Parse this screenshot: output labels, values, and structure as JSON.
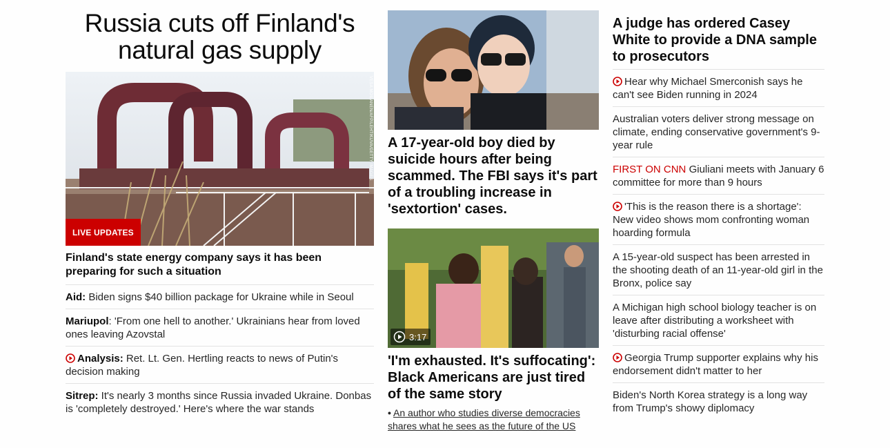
{
  "lead": {
    "headline": "Russia cuts off Finland's natural gas supply",
    "photo_credit": "VESA MOILANEN/AFP/LEHTIKUVA/GETTY IMAGES",
    "badge": "LIVE UPDATES",
    "subheadline": "Finland's state energy company says it has been preparing for such a situation",
    "related": [
      {
        "kicker": "Aid:",
        "text": " Biden signs $40 billion package for Ukraine while in Seoul",
        "video": false
      },
      {
        "kicker": "Mariupol",
        "text": ": 'From one hell to another.' Ukrainians hear from loved ones leaving Azovstal",
        "video": false
      },
      {
        "kicker": "Analysis:",
        "text": " Ret. Lt. Gen. Hertling reacts to news of Putin's decision making",
        "video": true
      },
      {
        "kicker": "Sitrep:",
        "text": " It's nearly 3 months since Russia invaded Ukraine. Donbas is 'completely destroyed.' Here's where the war stands",
        "video": false
      }
    ]
  },
  "middle": {
    "story1": {
      "headline": "A 17-year-old boy died by suicide hours after being scammed. The FBI says it's part of a troubling increase in 'sextortion' cases."
    },
    "story2": {
      "video_duration": "3:17",
      "headline": "'I'm exhausted. It's suffocating': Black Americans are just tired of the same story",
      "related_bullet": "•",
      "related": "An author who studies diverse democracies shares what he sees as the future of the US"
    }
  },
  "right": {
    "headline": "A judge has ordered Casey White to provide a DNA sample to prosecutors",
    "items": [
      {
        "text": "Hear why Michael Smerconish says he can't see Biden running in 2024",
        "video": true
      },
      {
        "text": "Australian voters deliver strong message on climate, ending conservative government's 9-year rule"
      },
      {
        "kicker": "FIRST ON CNN",
        "text": " Giuliani meets with January 6 committee for more than 9 hours"
      },
      {
        "text": "'This is the reason there is a shortage': New video shows mom confronting woman hoarding formula",
        "video": true
      },
      {
        "text": "A 15-year-old suspect has been arrested in the shooting death of an 11-year-old girl in the Bronx, police say"
      },
      {
        "text": "A Michigan high school biology teacher is on leave after distributing a worksheet with 'disturbing racial offense'"
      },
      {
        "text": "Georgia Trump supporter explains why his endorsement didn't matter to her",
        "video": true
      },
      {
        "text": "Biden's North Korea strategy is a long way from Trump's showy diplomacy"
      }
    ]
  },
  "colors": {
    "accent": "#cc0000",
    "divider": "#e2e2e2",
    "text": "#0c0c0c"
  },
  "icons": {
    "video": "play-circle-icon"
  }
}
